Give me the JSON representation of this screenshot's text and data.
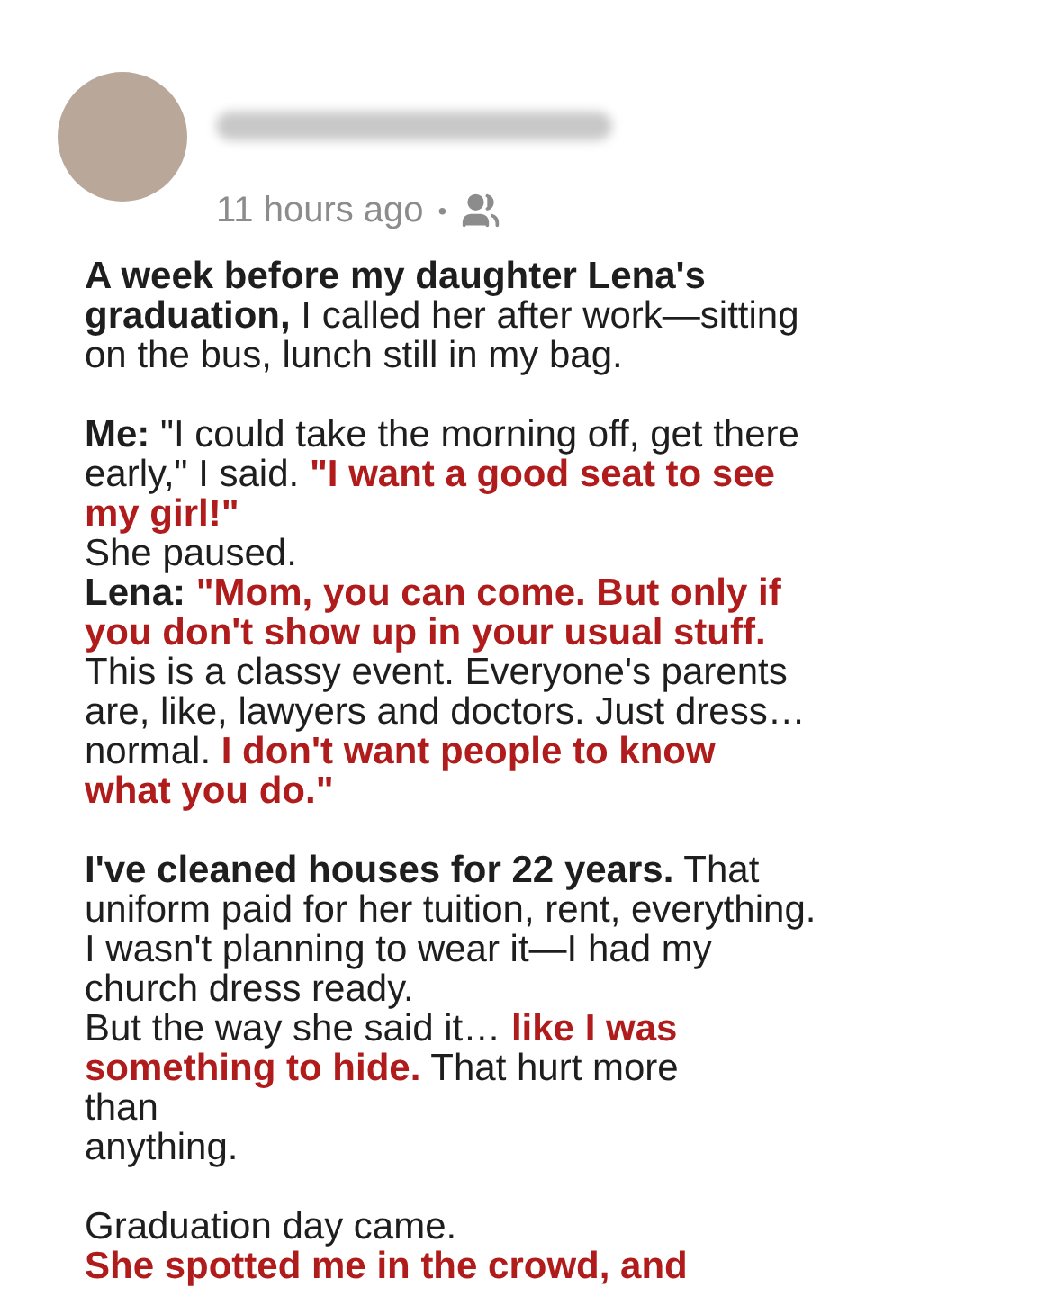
{
  "post": {
    "time": "11 hours ago",
    "separator": "•",
    "paragraphs": [
      [
        [
          {
            "kind": "bold",
            "text": "A week before my daughter Lena's"
          }
        ],
        [
          {
            "kind": "bold",
            "text": "graduation,"
          },
          {
            "kind": "plain",
            "text": " I called her after work—sitting"
          }
        ],
        [
          {
            "kind": "plain",
            "text": "on the bus, lunch still in my bag."
          }
        ]
      ],
      [
        [
          {
            "kind": "bold",
            "text": "Me:"
          },
          {
            "kind": "plain",
            "text": " \"I could take the morning off, get there"
          }
        ],
        [
          {
            "kind": "plain",
            "text": "early,\" I said. "
          },
          {
            "kind": "red",
            "text": "\"I want a good seat to see"
          }
        ],
        [
          {
            "kind": "red",
            "text": "my girl!\""
          }
        ],
        [
          {
            "kind": "plain",
            "text": "She paused."
          }
        ],
        [
          {
            "kind": "bold",
            "text": "Lena: "
          },
          {
            "kind": "red",
            "text": "\"Mom, you can come. But only if"
          }
        ],
        [
          {
            "kind": "red",
            "text": "you don't show up in your usual stuff."
          }
        ],
        [
          {
            "kind": "plain",
            "text": "This is a classy event. Everyone's parents"
          }
        ],
        [
          {
            "kind": "plain",
            "text": "are, like, lawyers and doctors. Just dress…"
          }
        ],
        [
          {
            "kind": "plain",
            "text": "normal. "
          },
          {
            "kind": "red",
            "text": "I don't want people to know"
          }
        ],
        [
          {
            "kind": "red",
            "text": "what you do.\""
          }
        ]
      ],
      [
        [
          {
            "kind": "bold",
            "text": "I've cleaned houses for 22 years."
          },
          {
            "kind": "plain",
            "text": " That"
          }
        ],
        [
          {
            "kind": "plain",
            "text": "uniform paid for her tuition, rent, everything."
          }
        ],
        [
          {
            "kind": "plain",
            "text": "I wasn't planning to wear it—I had my"
          }
        ],
        [
          {
            "kind": "plain",
            "text": "church dress ready."
          }
        ],
        [
          {
            "kind": "plain",
            "text": "But the way she said it… "
          },
          {
            "kind": "red",
            "text": "like I was"
          }
        ],
        [
          {
            "kind": "red",
            "text": "something to hide."
          },
          {
            "kind": "plain",
            "text": " That hurt more"
          }
        ],
        [
          {
            "kind": "plain",
            "text": "than"
          }
        ],
        [
          {
            "kind": "plain",
            "text": "anything."
          }
        ]
      ],
      [
        [
          {
            "kind": "plain",
            "text": "Graduation day came."
          }
        ],
        [
          {
            "kind": "red",
            "text": "She spotted me in the crowd, and"
          }
        ]
      ]
    ]
  }
}
